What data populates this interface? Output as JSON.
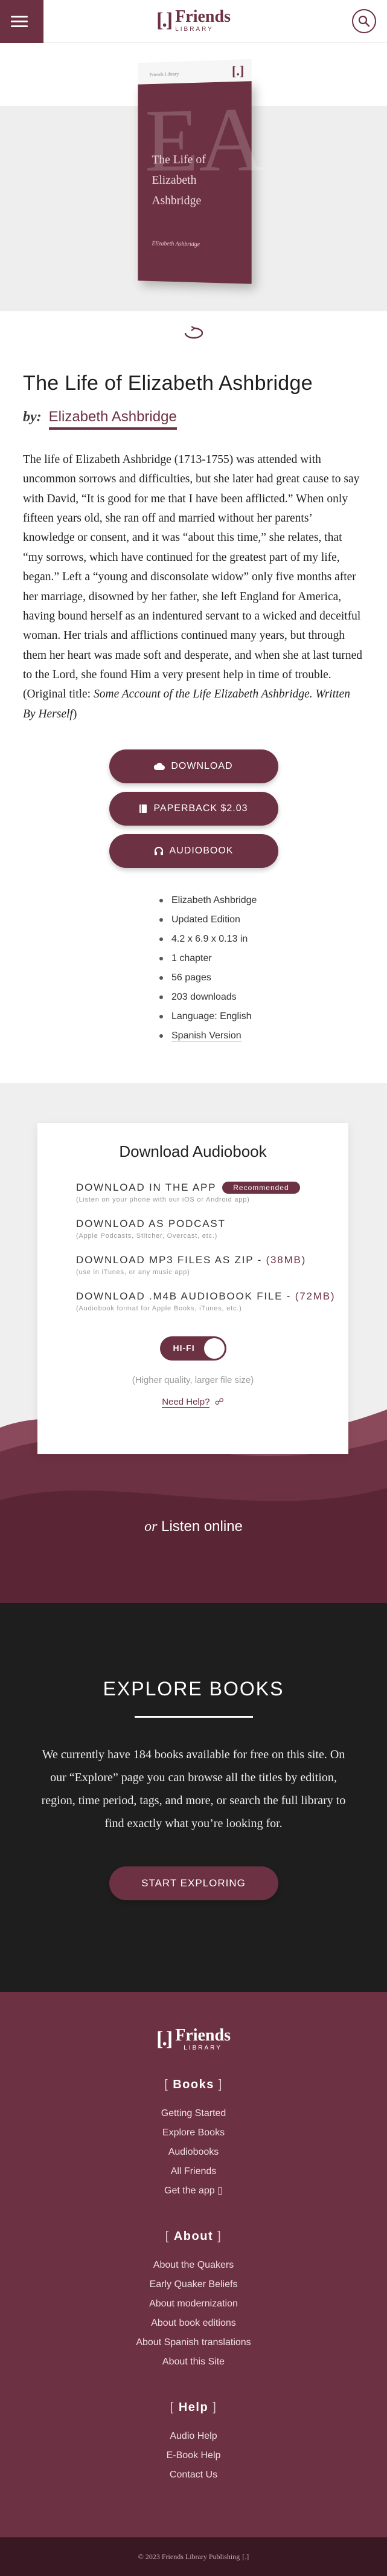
{
  "header": {
    "logo_mark": "[.]",
    "logo_title": "Friends",
    "logo_sub": "LIBRARY"
  },
  "cover": {
    "publisher": "Friends Library",
    "mark": "[.]",
    "initials": "EA",
    "title_line1": "The Life of",
    "title_line2": "Elizabeth Ashbridge",
    "author": "Elizabeth Ashbridge"
  },
  "book": {
    "title": "The Life of Elizabeth Ashbridge",
    "by": "by:",
    "author": "Elizabeth Ashbridge",
    "blurb": "The life of Elizabeth Ashbridge (1713-1755) was attended with uncommon sorrows and difficulties, but she later had great cause to say with David, “It is good for me that I have been afflicted.” When only fifteen years old, she ran off and married without her parents’ knowledge or consent, and it was “about this time,” she relates, that “my sorrows, which have continued for the greatest part of my life, began.” Left a “young and disconsolate widow” only five months after her marriage, disowned by her father, she left England for America, having bound herself as an indentured servant to a wicked and deceitful woman. Her trials and afflictions continued many years, but through them her heart was made soft and desperate, and when she at last turned to the Lord, she found Him a very present help in time of trouble. (Original title: ",
    "original_title": "Some Account of the Life Elizabeth Ashbridge. Written By Herself",
    "blurb_end": ")"
  },
  "buttons": {
    "download": "DOWNLOAD",
    "paperback": "PAPERBACK $2.03",
    "audiobook": "AUDIOBOOK"
  },
  "details": [
    "Elizabeth Ashbridge",
    "Updated Edition",
    "4.2 x 6.9 x 0.13 in",
    "1 chapter",
    "56 pages",
    "203 downloads",
    "Language: English",
    "Spanish Version"
  ],
  "audio": {
    "heading": "Download Audiobook",
    "options": [
      {
        "label": "DOWNLOAD IN THE APP",
        "badge": "Recommended",
        "size": "",
        "sub": "(Listen on your phone with our iOS or Android app)"
      },
      {
        "label": "DOWNLOAD AS PODCAST",
        "badge": "",
        "size": "",
        "sub": "(Apple Podcasts, Stitcher, Overcast, etc.)"
      },
      {
        "label": "DOWNLOAD MP3 FILES AS ZIP - ",
        "badge": "",
        "size": "(38MB)",
        "sub": "(use in iTunes, or any music app)"
      },
      {
        "label": "DOWNLOAD .M4B AUDIOBOOK FILE - ",
        "badge": "",
        "size": "(72MB)",
        "sub": "(Audiobook format for Apple Books, iTunes, etc.)"
      }
    ],
    "toggle_label": "HI-FI",
    "quality_note": "(Higher quality, larger file size)",
    "need_help": "Need Help?",
    "listen_or": "or",
    "listen_online": "Listen online"
  },
  "explore": {
    "heading": "EXPLORE BOOKS",
    "text": "We currently have 184 books available for free on this site. On our “Explore” page you can browse all the titles by edition, region, time period, tags, and more, or search the full library to find exactly what you’re looking for.",
    "button": "START EXPLORING"
  },
  "footer": {
    "sections": [
      {
        "title": "Books",
        "links": [
          "Getting Started",
          "Explore Books",
          "Audiobooks",
          "All Friends",
          "Get the app"
        ]
      },
      {
        "title": "About",
        "links": [
          "About the Quakers",
          "Early Quaker Beliefs",
          "About modernization",
          "About book editions",
          "About Spanish translations",
          "About this Site"
        ]
      },
      {
        "title": "Help",
        "links": [
          "Audio Help",
          "E-Book Help",
          "Contact Us"
        ]
      }
    ],
    "copyright": "© 2023 Friends Library Publishing",
    "copyright_mark": "[.]"
  },
  "colors": {
    "accent": "#6c3142",
    "dark": "#1e1e1e",
    "footer_bottom": "#3a1823"
  }
}
